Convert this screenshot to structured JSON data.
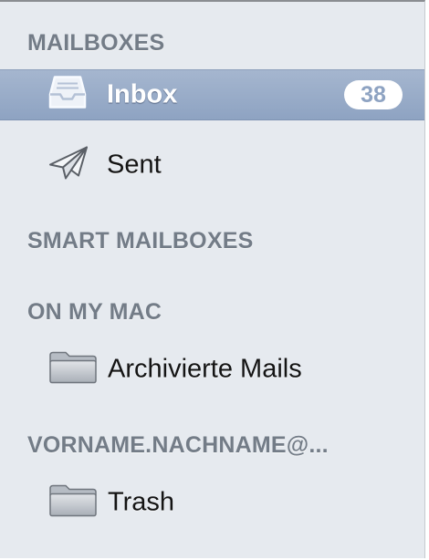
{
  "sidebar": {
    "sections": {
      "mailboxes": {
        "title": "MAILBOXES",
        "items": {
          "inbox": {
            "label": "Inbox",
            "icon": "inbox-tray-icon",
            "badge": "38",
            "selected": true
          },
          "sent": {
            "label": "Sent",
            "icon": "paper-plane-icon"
          }
        }
      },
      "smart_mailboxes": {
        "title": "SMART MAILBOXES"
      },
      "on_my_mac": {
        "title": "ON MY MAC",
        "items": {
          "archived": {
            "label": "Archivierte Mails",
            "icon": "folder-icon"
          }
        }
      },
      "account": {
        "title": "VORNAME.NACHNAME@...",
        "items": {
          "trash": {
            "label": "Trash",
            "icon": "folder-icon"
          }
        }
      }
    }
  },
  "colors": {
    "sidebar_background": "#e6eaef",
    "selection_highlight": "#8ea3c2",
    "section_header_text": "#737c87",
    "badge_background": "#ffffff"
  }
}
